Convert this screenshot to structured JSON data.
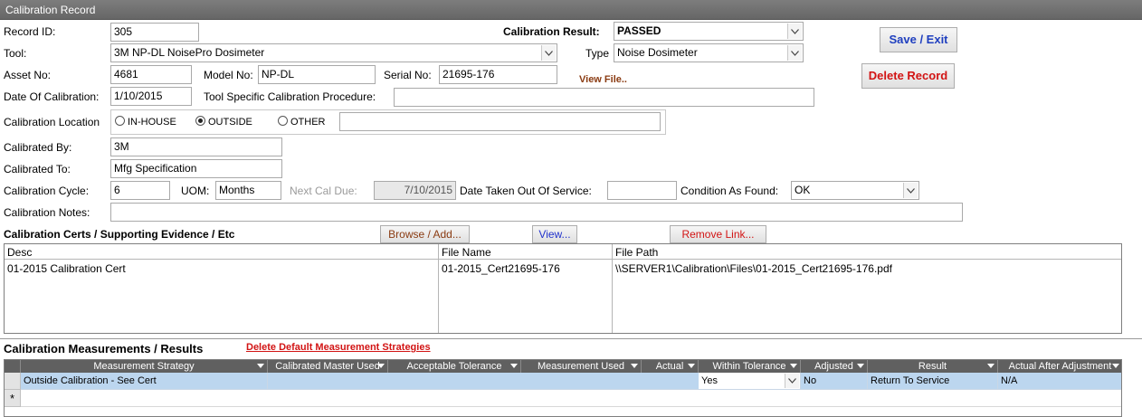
{
  "window": {
    "title": "Calibration Record"
  },
  "form": {
    "record_id": {
      "label": "Record ID:",
      "value": "305"
    },
    "tool": {
      "label": "Tool:",
      "value": "3M NP-DL NoisePro Dosimeter"
    },
    "asset_no": {
      "label": "Asset No:",
      "value": "4681"
    },
    "model_no": {
      "label": "Model No:",
      "value": "NP-DL"
    },
    "serial_no": {
      "label": "Serial No:",
      "value": "21695-176"
    },
    "view_file": "View File..",
    "date_of_calibration": {
      "label": "Date Of Calibration:",
      "value": "1/10/2015"
    },
    "tool_procedure": {
      "label": "Tool Specific Calibration Procedure:",
      "value": ""
    },
    "calibration_result": {
      "label": "Calibration Result:",
      "value": "PASSED"
    },
    "type": {
      "label": "Type",
      "value": "Noise Dosimeter"
    },
    "location": {
      "label": "Calibration Location",
      "options": [
        "IN-HOUSE",
        "OUTSIDE",
        "OTHER"
      ],
      "selected": "OUTSIDE",
      "other_value": ""
    },
    "calibrated_by": {
      "label": "Calibrated By:",
      "value": "3M"
    },
    "calibrated_to": {
      "label": "Calibrated To:",
      "value": "Mfg Specification"
    },
    "cycle": {
      "label": "Calibration Cycle:",
      "value": "6"
    },
    "uom": {
      "label": "UOM:",
      "value": "Months"
    },
    "next_cal_due": {
      "label": "Next Cal Due:",
      "value": "7/10/2015"
    },
    "date_out_of_service": {
      "label": "Date Taken Out Of Service:",
      "value": ""
    },
    "condition_found": {
      "label": "Condition As Found:",
      "value": "OK"
    },
    "notes": {
      "label": "Calibration Notes:",
      "value": ""
    }
  },
  "buttons": {
    "save_exit": "Save / Exit",
    "delete_record": "Delete Record",
    "browse_add": "Browse / Add...",
    "view": "View...",
    "remove_link": "Remove Link..."
  },
  "certs": {
    "section_title": "Calibration Certs / Supporting Evidence / Etc",
    "columns": [
      "Desc",
      "File Name",
      "File Path"
    ],
    "rows": [
      [
        "01-2015 Calibration Cert",
        "01-2015_Cert21695-176",
        "\\\\SERVER1\\Calibration\\Files\\01-2015_Cert21695-176.pdf"
      ]
    ]
  },
  "measurements": {
    "section_title": "Calibration Measurements / Results",
    "delete_link": "Delete Default Measurement Strategies",
    "columns": [
      "Measurement Strategy",
      "Calibrated Master Used",
      "Acceptable Tolerance",
      "Measurement Used",
      "Actual",
      "Within Tolerance",
      "Adjusted",
      "Result",
      "Actual After Adjustment"
    ],
    "rows": [
      [
        "Outside Calibration - See Cert",
        "",
        "",
        "",
        "",
        "Yes",
        "No",
        "Return To Service",
        "N/A"
      ]
    ],
    "new_row_marker": "*"
  },
  "colors": {
    "titlebar": "#6e6e6e",
    "selected_row": "#bcd6ef",
    "button_blue": "#1f3fbf",
    "button_red": "#d21414",
    "link_brown": "#8a3b12"
  }
}
